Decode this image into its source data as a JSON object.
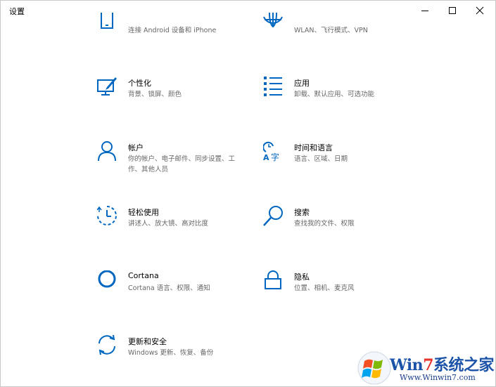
{
  "window": {
    "title": "设置"
  },
  "controls": {
    "minimize": "minimize-icon",
    "maximize": "maximize-icon",
    "close": "close-icon"
  },
  "accent": "#0067c0",
  "tiles": [
    {
      "title": "",
      "desc": "连接 Android 设备和 iPhone",
      "icon": "phone-icon"
    },
    {
      "title": "",
      "desc": "WLAN、飞行模式、VPN",
      "icon": "globe-icon"
    },
    {
      "title": "个性化",
      "desc": "背景、锁屏、颜色",
      "icon": "personalization-icon"
    },
    {
      "title": "应用",
      "desc": "卸载、默认应用、可选功能",
      "icon": "apps-list-icon"
    },
    {
      "title": "帐户",
      "desc": "你的帐户、电子邮件、同步设置、工作、其他人员",
      "icon": "person-icon"
    },
    {
      "title": "时间和语言",
      "desc": "语言、区域、日期",
      "icon": "time-language-icon"
    },
    {
      "title": "轻松使用",
      "desc": "讲述人、放大镜、高对比度",
      "icon": "ease-of-access-icon"
    },
    {
      "title": "搜索",
      "desc": "查找我的文件、权限",
      "icon": "search-icon"
    },
    {
      "title": "Cortana",
      "desc": "Cortana 语言、权限、通知",
      "icon": "cortana-icon"
    },
    {
      "title": "隐私",
      "desc": "位置、相机、麦克风",
      "icon": "lock-icon"
    },
    {
      "title": "更新和安全",
      "desc": "Windows 更新、恢复、备份",
      "icon": "sync-icon"
    }
  ],
  "watermark": {
    "brand_prefix": "Win",
    "brand_seven": "7",
    "brand_suffix": "系统之家",
    "url": "Www.Winwin7.com",
    "logo": "windows-logo-icon"
  }
}
